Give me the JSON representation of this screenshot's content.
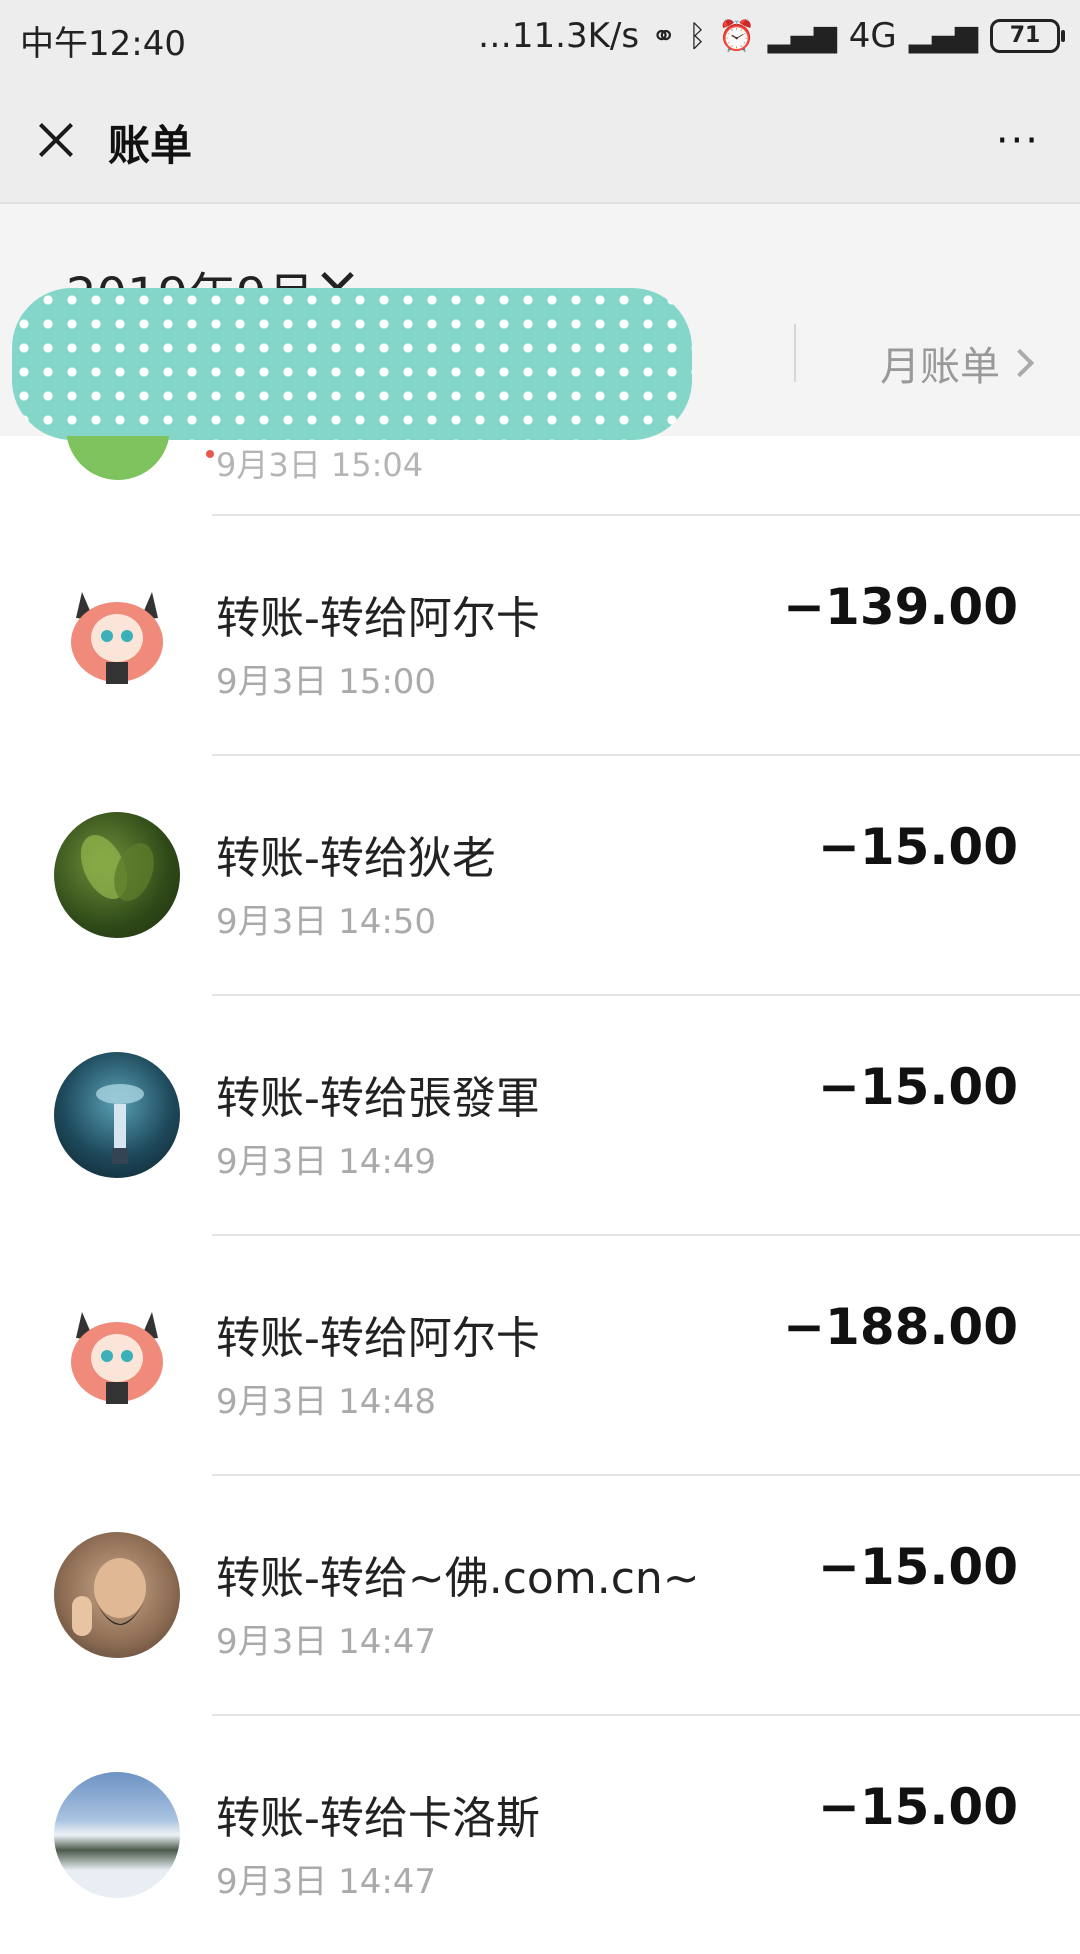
{
  "status_bar": {
    "time": "中午12:40",
    "network_speed": "…11.3K/s",
    "network_type": "4G",
    "battery": "71"
  },
  "nav": {
    "title": "账单",
    "more_label": "···"
  },
  "month_header": {
    "month": "2019年9月",
    "monthly_bill_label": "月账单"
  },
  "partial_row": {
    "time": "9月3日 15:04"
  },
  "transactions": [
    {
      "title": "转账-转给阿尔卡",
      "time": "9月3日 15:00",
      "amount": "−139.00",
      "avatar": "anime-girl-avatar"
    },
    {
      "title": "转账-转给狄老",
      "time": "9月3日 14:50",
      "amount": "−15.00",
      "avatar": "plant-photo-avatar"
    },
    {
      "title": "转账-转给張發軍",
      "time": "9月3日 14:49",
      "amount": "−15.00",
      "avatar": "rain-scene-avatar"
    },
    {
      "title": "转账-转给阿尔卡",
      "time": "9月3日 14:48",
      "amount": "−188.00",
      "avatar": "anime-girl-avatar"
    },
    {
      "title": "转账-转给~佛.com.cn~",
      "time": "9月3日 14:47",
      "amount": "−15.00",
      "avatar": "bearded-man-avatar"
    },
    {
      "title": "转账-转给卡洛斯",
      "time": "9月3日 14:47",
      "amount": "−15.00",
      "avatar": "snow-landscape-avatar"
    }
  ]
}
